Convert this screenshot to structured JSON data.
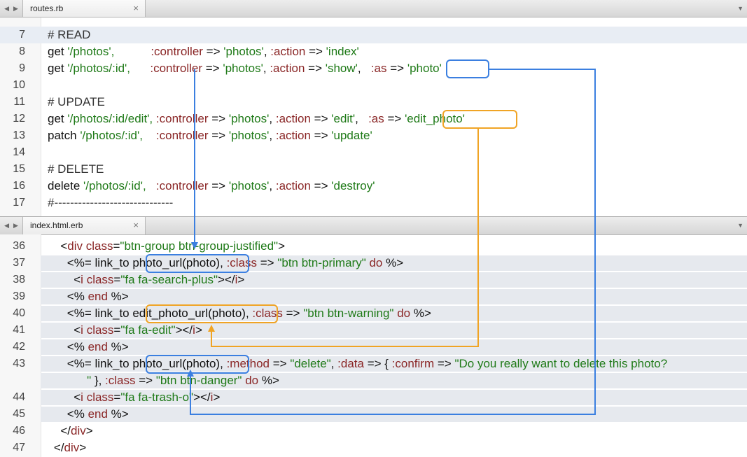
{
  "editor": {
    "nav_back": "◀",
    "nav_forward": "▶",
    "dropdown": "▼",
    "close_glyph": "×"
  },
  "top_tab": {
    "label": "routes.rb"
  },
  "bottom_tab": {
    "label": "index.html.erb"
  },
  "colors": {
    "photo_box": "#3b7fe0",
    "edit_photo_box": "#f0a425",
    "string": "#1f7a18",
    "symbol": "#8a2626"
  },
  "routes_lines": [
    {
      "num": "7",
      "tokens": [
        [
          "# READ",
          "com"
        ]
      ]
    },
    {
      "num": "8",
      "tokens": [
        [
          "get ",
          "plain"
        ],
        [
          "'/photos',",
          "str"
        ],
        [
          "           ",
          "plain"
        ],
        [
          ":controller",
          "sym"
        ],
        [
          " => ",
          "plain"
        ],
        [
          "'photos'",
          "str"
        ],
        [
          ", ",
          "plain"
        ],
        [
          ":action",
          "sym"
        ],
        [
          " => ",
          "plain"
        ],
        [
          "'index'",
          "str"
        ]
      ]
    },
    {
      "num": "9",
      "tokens": [
        [
          "get ",
          "plain"
        ],
        [
          "'/photos/:id',",
          "str"
        ],
        [
          "      ",
          "plain"
        ],
        [
          ":controller",
          "sym"
        ],
        [
          " => ",
          "plain"
        ],
        [
          "'photos'",
          "str"
        ],
        [
          ", ",
          "plain"
        ],
        [
          ":action",
          "sym"
        ],
        [
          " => ",
          "plain"
        ],
        [
          "'show'",
          "str"
        ],
        [
          ",   ",
          "plain"
        ],
        [
          ":as",
          "sym"
        ],
        [
          " => ",
          "plain"
        ],
        [
          "'photo'",
          "str"
        ]
      ]
    },
    {
      "num": "10",
      "tokens": []
    },
    {
      "num": "11",
      "tokens": [
        [
          "# UPDATE",
          "com"
        ]
      ]
    },
    {
      "num": "12",
      "tokens": [
        [
          "get ",
          "plain"
        ],
        [
          "'/photos/:id/edit',",
          "str"
        ],
        [
          " ",
          "plain"
        ],
        [
          ":controller",
          "sym"
        ],
        [
          " => ",
          "plain"
        ],
        [
          "'photos'",
          "str"
        ],
        [
          ", ",
          "plain"
        ],
        [
          ":action",
          "sym"
        ],
        [
          " => ",
          "plain"
        ],
        [
          "'edit'",
          "str"
        ],
        [
          ",   ",
          "plain"
        ],
        [
          ":as",
          "sym"
        ],
        [
          " => ",
          "plain"
        ],
        [
          "'edit_photo'",
          "str"
        ]
      ]
    },
    {
      "num": "13",
      "tokens": [
        [
          "patch ",
          "plain"
        ],
        [
          "'/photos/:id',",
          "str"
        ],
        [
          "    ",
          "plain"
        ],
        [
          ":controller",
          "sym"
        ],
        [
          " => ",
          "plain"
        ],
        [
          "'photos'",
          "str"
        ],
        [
          ", ",
          "plain"
        ],
        [
          ":action",
          "sym"
        ],
        [
          " => ",
          "plain"
        ],
        [
          "'update'",
          "str"
        ]
      ]
    },
    {
      "num": "14",
      "tokens": []
    },
    {
      "num": "15",
      "tokens": [
        [
          "# DELETE",
          "com"
        ]
      ]
    },
    {
      "num": "16",
      "tokens": [
        [
          "delete ",
          "plain"
        ],
        [
          "'/photos/:id',",
          "str"
        ],
        [
          "   ",
          "plain"
        ],
        [
          ":controller",
          "sym"
        ],
        [
          " => ",
          "plain"
        ],
        [
          "'photos'",
          "str"
        ],
        [
          ", ",
          "plain"
        ],
        [
          ":action",
          "sym"
        ],
        [
          " => ",
          "plain"
        ],
        [
          "'destroy'",
          "str"
        ]
      ]
    },
    {
      "num": "17",
      "tokens": [
        [
          "#------------------------------",
          "com"
        ]
      ]
    }
  ],
  "erb_lines": [
    {
      "num": "36",
      "tokens": [
        [
          "      <",
          "plain"
        ],
        [
          "div",
          "kw"
        ],
        [
          " ",
          "plain"
        ],
        [
          "class",
          "sym"
        ],
        [
          "=",
          "plain"
        ],
        [
          "\"btn-group btn-group-justified\"",
          "str"
        ],
        [
          ">",
          "plain"
        ]
      ]
    },
    {
      "num": "37",
      "tokens": [
        [
          "        <%= link_to ",
          "plain"
        ],
        [
          "photo_url(photo)",
          "plain"
        ],
        [
          ", ",
          "plain"
        ],
        [
          ":class",
          "sym"
        ],
        [
          " => ",
          "plain"
        ],
        [
          "\"btn btn-primary\"",
          "str"
        ],
        [
          " ",
          "plain"
        ],
        [
          "do",
          "kw"
        ],
        [
          " %>",
          "plain"
        ]
      ]
    },
    {
      "num": "38",
      "tokens": [
        [
          "          <",
          "plain"
        ],
        [
          "i",
          "kw"
        ],
        [
          " ",
          "plain"
        ],
        [
          "class",
          "sym"
        ],
        [
          "=",
          "plain"
        ],
        [
          "\"fa fa-search-plus\"",
          "str"
        ],
        [
          "></",
          "plain"
        ],
        [
          "i",
          "kw"
        ],
        [
          ">",
          "plain"
        ]
      ]
    },
    {
      "num": "39",
      "tokens": [
        [
          "        <% ",
          "plain"
        ],
        [
          "end",
          "kw"
        ],
        [
          " %>",
          "plain"
        ]
      ]
    },
    {
      "num": "40",
      "tokens": [
        [
          "        <%= link_to ",
          "plain"
        ],
        [
          "edit_photo_url(photo)",
          "plain"
        ],
        [
          ", ",
          "plain"
        ],
        [
          ":class",
          "sym"
        ],
        [
          " => ",
          "plain"
        ],
        [
          "\"btn btn-warning\"",
          "str"
        ],
        [
          " ",
          "plain"
        ],
        [
          "do",
          "kw"
        ],
        [
          " %>",
          "plain"
        ]
      ]
    },
    {
      "num": "41",
      "tokens": [
        [
          "          <",
          "plain"
        ],
        [
          "i",
          "kw"
        ],
        [
          " ",
          "plain"
        ],
        [
          "class",
          "sym"
        ],
        [
          "=",
          "plain"
        ],
        [
          "\"fa fa-edit\"",
          "str"
        ],
        [
          "></",
          "plain"
        ],
        [
          "i",
          "kw"
        ],
        [
          ">",
          "plain"
        ]
      ]
    },
    {
      "num": "42",
      "tokens": [
        [
          "        <% ",
          "plain"
        ],
        [
          "end",
          "kw"
        ],
        [
          " %>",
          "plain"
        ]
      ]
    },
    {
      "num": "43",
      "tokens": [
        [
          "        <%= link_to ",
          "plain"
        ],
        [
          "photo_url(photo)",
          "plain"
        ],
        [
          ", ",
          "plain"
        ],
        [
          ":method",
          "sym"
        ],
        [
          " => ",
          "plain"
        ],
        [
          "\"delete\"",
          "str"
        ],
        [
          ", ",
          "plain"
        ],
        [
          ":data",
          "sym"
        ],
        [
          " => { ",
          "plain"
        ],
        [
          ":confirm",
          "sym"
        ],
        [
          " => ",
          "plain"
        ],
        [
          "\"Do you really want to delete this photo?",
          "str"
        ]
      ]
    },
    {
      "num": "",
      "tokens": [
        [
          "              ",
          "plain"
        ],
        [
          "\"",
          "str"
        ],
        [
          " }, ",
          "plain"
        ],
        [
          ":class",
          "sym"
        ],
        [
          " => ",
          "plain"
        ],
        [
          "\"btn btn-danger\"",
          "str"
        ],
        [
          " ",
          "plain"
        ],
        [
          "do",
          "kw"
        ],
        [
          " %>",
          "plain"
        ]
      ]
    },
    {
      "num": "44",
      "tokens": [
        [
          "          <",
          "plain"
        ],
        [
          "i",
          "kw"
        ],
        [
          " ",
          "plain"
        ],
        [
          "class",
          "sym"
        ],
        [
          "=",
          "plain"
        ],
        [
          "\"fa fa-trash-o\"",
          "str"
        ],
        [
          "></",
          "plain"
        ],
        [
          "i",
          "kw"
        ],
        [
          ">",
          "plain"
        ]
      ]
    },
    {
      "num": "45",
      "tokens": [
        [
          "        <% ",
          "plain"
        ],
        [
          "end",
          "kw"
        ],
        [
          " %>",
          "plain"
        ]
      ]
    },
    {
      "num": "46",
      "tokens": [
        [
          "      </",
          "plain"
        ],
        [
          "div",
          "kw"
        ],
        [
          ">",
          "plain"
        ]
      ]
    },
    {
      "num": "47",
      "tokens": [
        [
          "    </",
          "plain"
        ],
        [
          "div",
          "kw"
        ],
        [
          ">",
          "plain"
        ]
      ]
    }
  ]
}
